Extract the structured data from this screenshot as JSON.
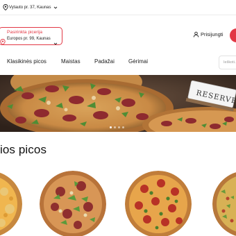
{
  "topbar": {
    "address": "Vytauto pr. 37, Kaunas",
    "icons": [
      "location-pin-icon",
      "chevron-down-icon"
    ]
  },
  "store_picker": {
    "label": "Pasirinkta picerija",
    "value": "Europos pr. 99, Kaunas",
    "icons": [
      "location-pin-icon",
      "chevron-down-icon"
    ]
  },
  "header": {
    "login_label": "Prisijungti",
    "icons": [
      "user-icon"
    ]
  },
  "nav": {
    "tabs": [
      "Klasikinės picos",
      "Maistas",
      "Padažai",
      "Gėrimai"
    ]
  },
  "search": {
    "placeholder": "Ieškoti..."
  },
  "banner": {
    "sign_text": "RESERVED",
    "slides": 4,
    "active_slide": 1
  },
  "section": {
    "title": "ios picos"
  },
  "colors": {
    "brand": "#e23744",
    "text": "#1c1c1c"
  }
}
